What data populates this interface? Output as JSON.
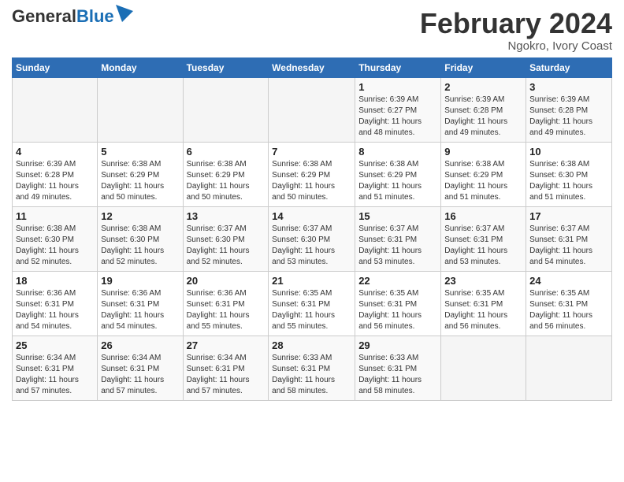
{
  "header": {
    "logo_general": "General",
    "logo_blue": "Blue",
    "main_title": "February 2024",
    "subtitle": "Ngokro, Ivory Coast"
  },
  "calendar": {
    "days_of_week": [
      "Sunday",
      "Monday",
      "Tuesday",
      "Wednesday",
      "Thursday",
      "Friday",
      "Saturday"
    ],
    "weeks": [
      [
        {
          "day": "",
          "info": ""
        },
        {
          "day": "",
          "info": ""
        },
        {
          "day": "",
          "info": ""
        },
        {
          "day": "",
          "info": ""
        },
        {
          "day": "1",
          "info": "Sunrise: 6:39 AM\nSunset: 6:27 PM\nDaylight: 11 hours\nand 48 minutes."
        },
        {
          "day": "2",
          "info": "Sunrise: 6:39 AM\nSunset: 6:28 PM\nDaylight: 11 hours\nand 49 minutes."
        },
        {
          "day": "3",
          "info": "Sunrise: 6:39 AM\nSunset: 6:28 PM\nDaylight: 11 hours\nand 49 minutes."
        }
      ],
      [
        {
          "day": "4",
          "info": "Sunrise: 6:39 AM\nSunset: 6:28 PM\nDaylight: 11 hours\nand 49 minutes."
        },
        {
          "day": "5",
          "info": "Sunrise: 6:38 AM\nSunset: 6:29 PM\nDaylight: 11 hours\nand 50 minutes."
        },
        {
          "day": "6",
          "info": "Sunrise: 6:38 AM\nSunset: 6:29 PM\nDaylight: 11 hours\nand 50 minutes."
        },
        {
          "day": "7",
          "info": "Sunrise: 6:38 AM\nSunset: 6:29 PM\nDaylight: 11 hours\nand 50 minutes."
        },
        {
          "day": "8",
          "info": "Sunrise: 6:38 AM\nSunset: 6:29 PM\nDaylight: 11 hours\nand 51 minutes."
        },
        {
          "day": "9",
          "info": "Sunrise: 6:38 AM\nSunset: 6:29 PM\nDaylight: 11 hours\nand 51 minutes."
        },
        {
          "day": "10",
          "info": "Sunrise: 6:38 AM\nSunset: 6:30 PM\nDaylight: 11 hours\nand 51 minutes."
        }
      ],
      [
        {
          "day": "11",
          "info": "Sunrise: 6:38 AM\nSunset: 6:30 PM\nDaylight: 11 hours\nand 52 minutes."
        },
        {
          "day": "12",
          "info": "Sunrise: 6:38 AM\nSunset: 6:30 PM\nDaylight: 11 hours\nand 52 minutes."
        },
        {
          "day": "13",
          "info": "Sunrise: 6:37 AM\nSunset: 6:30 PM\nDaylight: 11 hours\nand 52 minutes."
        },
        {
          "day": "14",
          "info": "Sunrise: 6:37 AM\nSunset: 6:30 PM\nDaylight: 11 hours\nand 53 minutes."
        },
        {
          "day": "15",
          "info": "Sunrise: 6:37 AM\nSunset: 6:31 PM\nDaylight: 11 hours\nand 53 minutes."
        },
        {
          "day": "16",
          "info": "Sunrise: 6:37 AM\nSunset: 6:31 PM\nDaylight: 11 hours\nand 53 minutes."
        },
        {
          "day": "17",
          "info": "Sunrise: 6:37 AM\nSunset: 6:31 PM\nDaylight: 11 hours\nand 54 minutes."
        }
      ],
      [
        {
          "day": "18",
          "info": "Sunrise: 6:36 AM\nSunset: 6:31 PM\nDaylight: 11 hours\nand 54 minutes."
        },
        {
          "day": "19",
          "info": "Sunrise: 6:36 AM\nSunset: 6:31 PM\nDaylight: 11 hours\nand 54 minutes."
        },
        {
          "day": "20",
          "info": "Sunrise: 6:36 AM\nSunset: 6:31 PM\nDaylight: 11 hours\nand 55 minutes."
        },
        {
          "day": "21",
          "info": "Sunrise: 6:35 AM\nSunset: 6:31 PM\nDaylight: 11 hours\nand 55 minutes."
        },
        {
          "day": "22",
          "info": "Sunrise: 6:35 AM\nSunset: 6:31 PM\nDaylight: 11 hours\nand 56 minutes."
        },
        {
          "day": "23",
          "info": "Sunrise: 6:35 AM\nSunset: 6:31 PM\nDaylight: 11 hours\nand 56 minutes."
        },
        {
          "day": "24",
          "info": "Sunrise: 6:35 AM\nSunset: 6:31 PM\nDaylight: 11 hours\nand 56 minutes."
        }
      ],
      [
        {
          "day": "25",
          "info": "Sunrise: 6:34 AM\nSunset: 6:31 PM\nDaylight: 11 hours\nand 57 minutes."
        },
        {
          "day": "26",
          "info": "Sunrise: 6:34 AM\nSunset: 6:31 PM\nDaylight: 11 hours\nand 57 minutes."
        },
        {
          "day": "27",
          "info": "Sunrise: 6:34 AM\nSunset: 6:31 PM\nDaylight: 11 hours\nand 57 minutes."
        },
        {
          "day": "28",
          "info": "Sunrise: 6:33 AM\nSunset: 6:31 PM\nDaylight: 11 hours\nand 58 minutes."
        },
        {
          "day": "29",
          "info": "Sunrise: 6:33 AM\nSunset: 6:31 PM\nDaylight: 11 hours\nand 58 minutes."
        },
        {
          "day": "",
          "info": ""
        },
        {
          "day": "",
          "info": ""
        }
      ]
    ]
  }
}
